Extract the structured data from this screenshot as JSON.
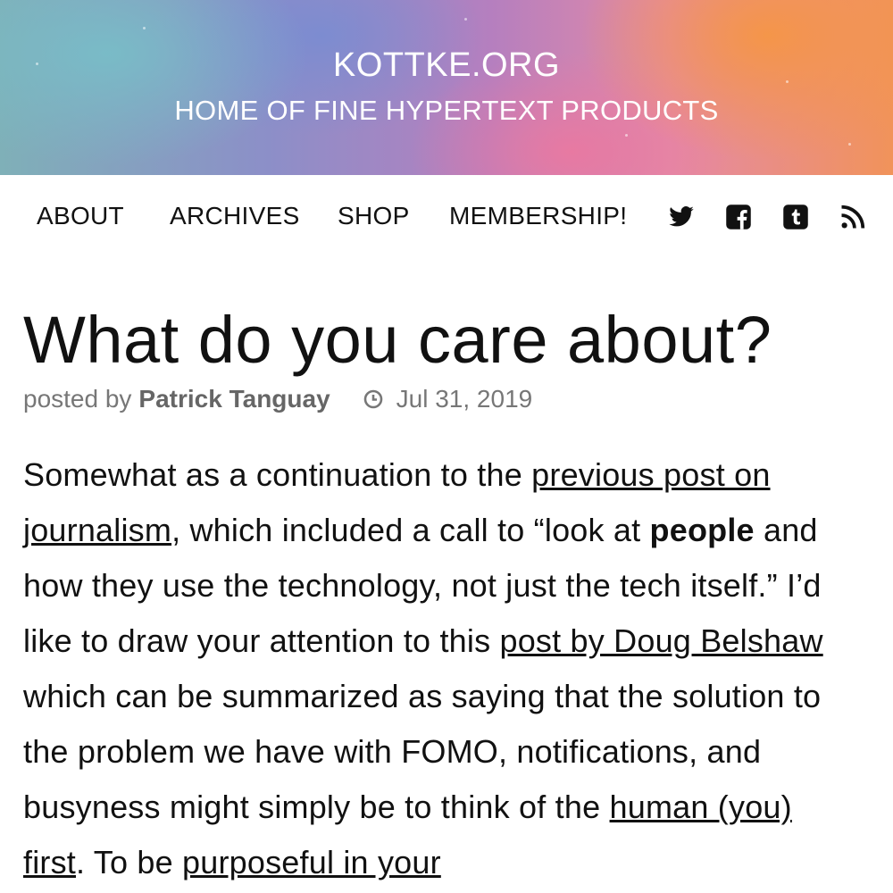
{
  "header": {
    "site_title": "KOTTKE.ORG",
    "tagline": "HOME OF FINE HYPERTEXT PRODUCTS"
  },
  "nav": {
    "items": [
      "ABOUT",
      "ARCHIVES",
      "SHOP",
      "MEMBERSHIP!"
    ],
    "icons": [
      "twitter-icon",
      "facebook-icon",
      "tumblr-icon",
      "rss-icon"
    ]
  },
  "post": {
    "title": "What do you care about?",
    "posted_by_label": "posted by",
    "author": "Patrick Tanguay",
    "date": "Jul 31, 2019",
    "p1_text_a": "Somewhat as a continuation to the ",
    "p1_link_a": "previous post on journalism",
    "p1_text_b": ", which included a call to “look at ",
    "p1_bold": "people",
    "p1_text_c": " and how they use the technology, not just the tech itself.” I’d like to draw your attention to this ",
    "p1_link_b": "post by Doug Belshaw",
    "p1_text_d": " which can be summarized as saying that the solution to the problem we have with FOMO, notifications, and busyness might simply be to think of the ",
    "p1_link_c": "human (you) first",
    "p1_text_e": ". To be ",
    "p1_link_d": "purposeful in your"
  },
  "colors": {
    "text": "#111111",
    "meta": "#777777",
    "banner_text": "#ffffff"
  }
}
